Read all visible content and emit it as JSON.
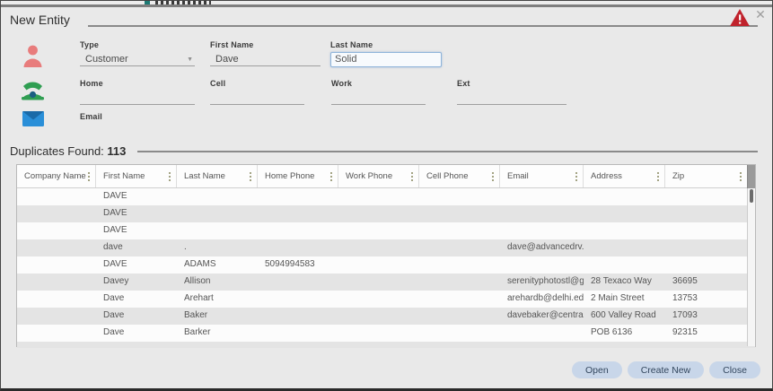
{
  "dialog": {
    "title": "New Entity",
    "close_label": "✕"
  },
  "form": {
    "type": {
      "label": "Type",
      "value": "Customer"
    },
    "first_name": {
      "label": "First Name",
      "value": "Dave"
    },
    "last_name": {
      "label": "Last Name",
      "value": "Solid"
    },
    "home": {
      "label": "Home",
      "value": ""
    },
    "cell": {
      "label": "Cell",
      "value": ""
    },
    "work": {
      "label": "Work",
      "value": ""
    },
    "ext": {
      "label": "Ext",
      "value": ""
    },
    "email": {
      "label": "Email",
      "value": ""
    }
  },
  "duplicates": {
    "label": "Duplicates Found:",
    "count": "113",
    "columns": [
      "Company Name",
      "First Name",
      "Last Name",
      "Home Phone",
      "Work Phone",
      "Cell Phone",
      "Email",
      "Address",
      "Zip"
    ],
    "rows": [
      [
        "",
        "DAVE",
        "",
        "",
        "",
        "",
        "",
        "",
        ""
      ],
      [
        "",
        "DAVE",
        "",
        "",
        "",
        "",
        "",
        "",
        ""
      ],
      [
        "",
        "DAVE",
        "",
        "",
        "",
        "",
        "",
        "",
        ""
      ],
      [
        "",
        "dave",
        ".",
        "",
        "",
        "",
        "dave@advancedrv.net",
        "",
        ""
      ],
      [
        "",
        "DAVE",
        "ADAMS",
        "5094994583",
        "",
        "",
        "",
        "",
        ""
      ],
      [
        "",
        "Davey",
        "Allison",
        "",
        "",
        "",
        "serenityphotostl@gm...",
        "28 Texaco Way",
        "36695"
      ],
      [
        "",
        "Dave",
        "Arehart",
        "",
        "",
        "",
        "arehardb@delhi.edu",
        "2 Main Street",
        "13753"
      ],
      [
        "",
        "Dave",
        "Baker",
        "",
        "",
        "",
        "davebaker@centralpe...",
        "600 Valley Road",
        "17093"
      ],
      [
        "",
        "Dave",
        "Barker",
        "",
        "",
        "",
        "",
        "POB 6136",
        "92315"
      ]
    ]
  },
  "footer": {
    "open": "Open",
    "create_new": "Create New",
    "close": "Close"
  },
  "colors": {
    "warning_red": "#c0222c",
    "person_icon": "#e87c7c",
    "phone_icon": "#2f9e52",
    "envelope_icon": "#2a8fd8",
    "focus_border": "#8fb4da",
    "button_bg": "#c8d6e9",
    "alt_row": "#e4e4e4"
  }
}
